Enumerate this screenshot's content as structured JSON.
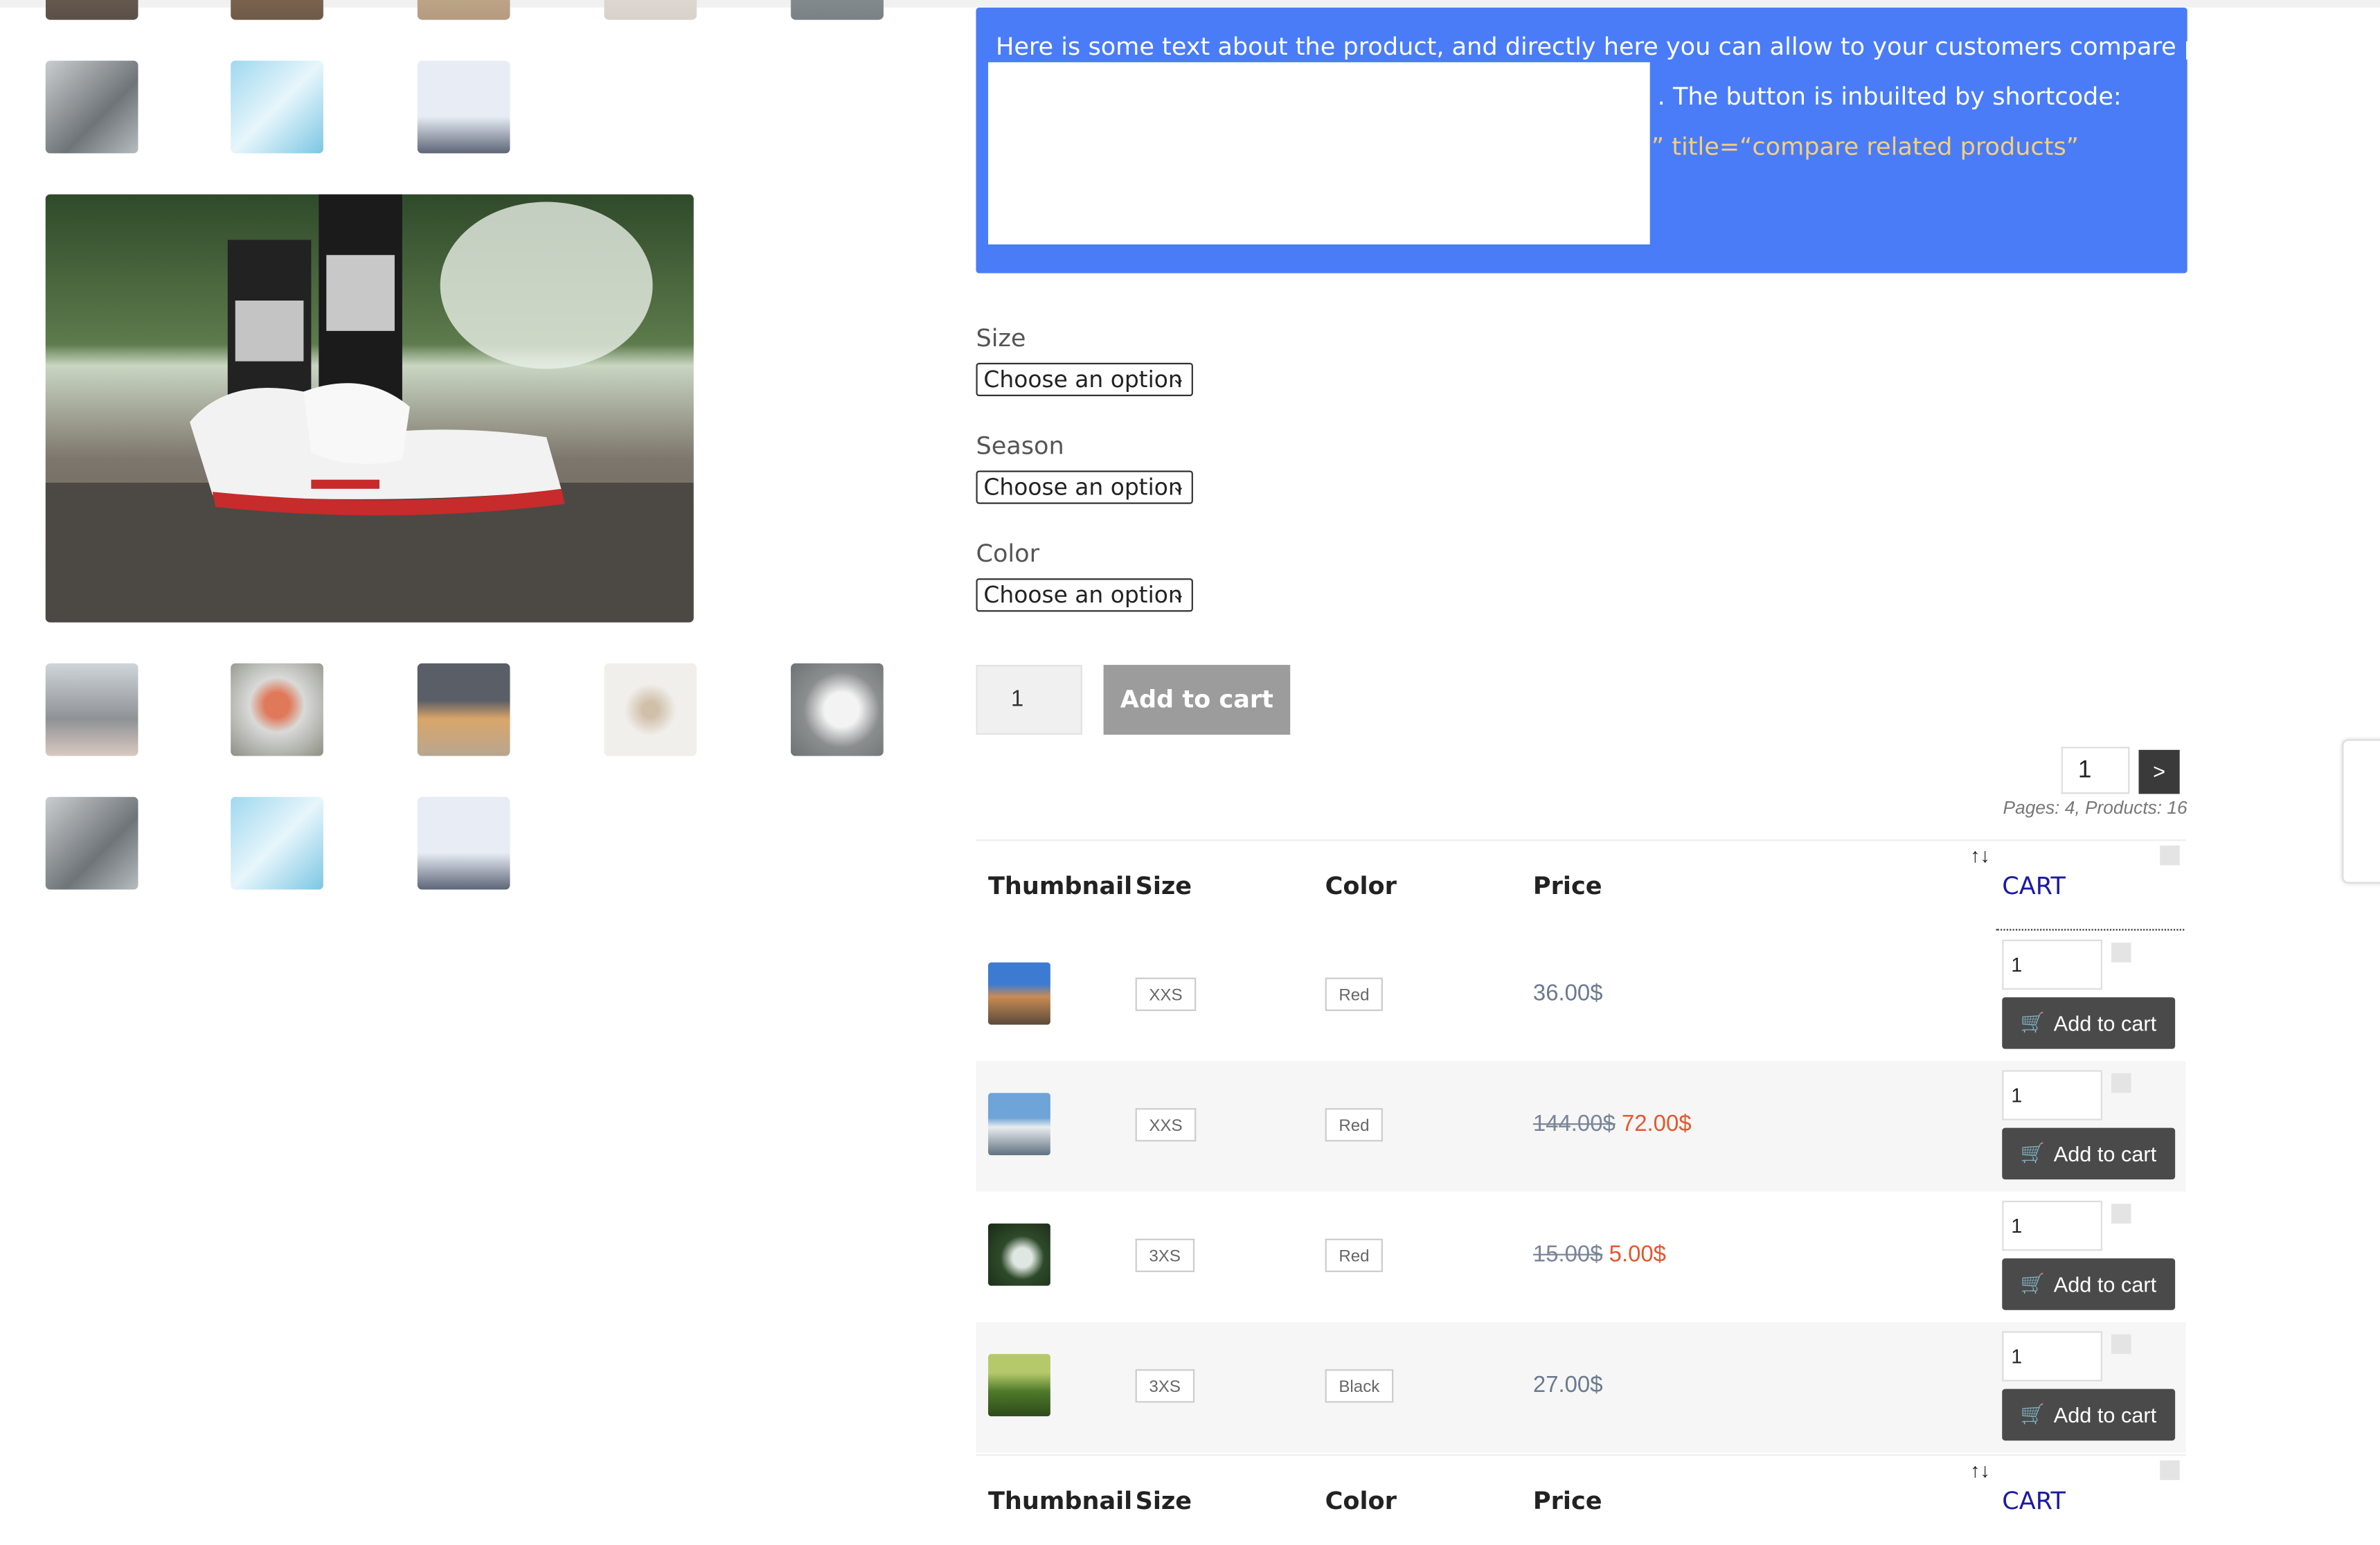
{
  "promo": {
    "line1": "Here is some text about the product, and directly here you can allow to your customers compare products",
    "line2": ". The button is inbuilted by shortcode:",
    "line3": "” title=“compare related products”"
  },
  "attributes": [
    {
      "label": "Size",
      "value": "Choose an option"
    },
    {
      "label": "Season",
      "value": "Choose an option"
    },
    {
      "label": "Color",
      "value": "Choose an option"
    }
  ],
  "purchase": {
    "qty": "1",
    "button": "Add to cart"
  },
  "pagination": {
    "page": "1",
    "next": ">",
    "info": "Pages: 4, Products: 16"
  },
  "table": {
    "headers": {
      "thumbnail": "Thumbnail",
      "size": "Size",
      "color": "Color",
      "price": "Price",
      "cart": "CART",
      "sort": "↑↓"
    },
    "rows": [
      {
        "size": "XXS",
        "color": "Red",
        "price": "36.00$",
        "old_price": "",
        "sale_price": "",
        "qty": "1",
        "button": "Add to cart"
      },
      {
        "size": "XXS",
        "color": "Red",
        "price": "",
        "old_price": "144.00$",
        "sale_price": "72.00$",
        "qty": "1",
        "button": "Add to cart"
      },
      {
        "size": "3XS",
        "color": "Red",
        "price": "",
        "old_price": "15.00$",
        "sale_price": "5.00$",
        "qty": "1",
        "button": "Add to cart"
      },
      {
        "size": "3XS",
        "color": "Black",
        "price": "27.00$",
        "old_price": "",
        "sale_price": "",
        "qty": "1",
        "button": "Add to cart"
      }
    ]
  },
  "icons": {
    "cart": "cart-icon",
    "chevron": "chevron-down-icon",
    "sort": "sort-icon"
  },
  "colors": {
    "promo_bg": "#4a7cf8",
    "sale": "#e4572e",
    "cart_header": "#1c1aa3"
  }
}
